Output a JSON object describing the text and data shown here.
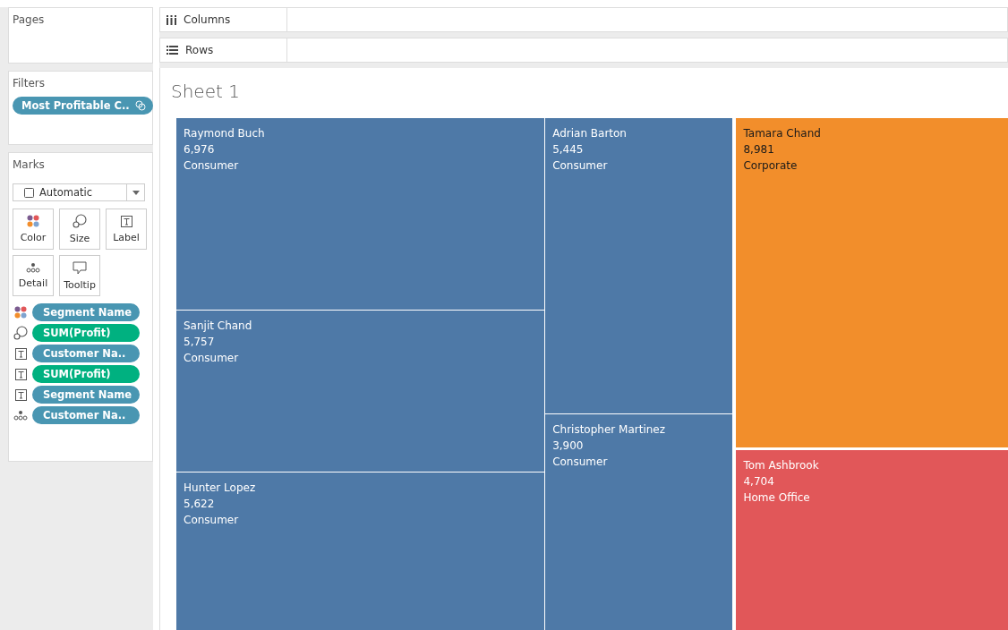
{
  "pages": {
    "title": "Pages"
  },
  "shelves": [
    {
      "kind": "columns",
      "label": "Columns"
    },
    {
      "kind": "rows",
      "label": "Rows"
    }
  ],
  "filters": {
    "title": "Filters",
    "pills": [
      {
        "label": "Most Profitable C..",
        "kind": "set"
      }
    ]
  },
  "marks": {
    "title": "Marks",
    "mark_type": "Automatic",
    "cards": [
      {
        "kind": "color",
        "label": "Color"
      },
      {
        "kind": "size",
        "label": "Size"
      },
      {
        "kind": "label",
        "label": "Label"
      },
      {
        "kind": "detail",
        "label": "Detail"
      },
      {
        "kind": "tooltip",
        "label": "Tooltip"
      }
    ],
    "fields": [
      {
        "kind": "color",
        "label": "Segment Name",
        "color": "#4996b2"
      },
      {
        "kind": "size",
        "label": "SUM(Profit)",
        "color": "#00b180"
      },
      {
        "kind": "label",
        "label": "Customer Na..",
        "color": "#4996b2"
      },
      {
        "kind": "label",
        "label": "SUM(Profit)",
        "color": "#00b180"
      },
      {
        "kind": "label",
        "label": "Segment Name",
        "color": "#4996b2"
      },
      {
        "kind": "detail",
        "label": "Customer Na..",
        "color": "#4996b2"
      }
    ]
  },
  "sheet": {
    "title": "Sheet 1",
    "treemap": [
      {
        "tiles": [
          {
            "name": "Raymond Buch",
            "value": "6,976",
            "segment": "Consumer",
            "color": "#4e79a7"
          },
          {
            "name": "Sanjit Chand",
            "value": "5,757",
            "segment": "Consumer",
            "color": "#4e79a7"
          },
          {
            "name": "Hunter Lopez",
            "value": "5,622",
            "segment": "Consumer",
            "color": "#4e79a7"
          }
        ]
      },
      {
        "tiles": [
          {
            "name": "Adrian Barton",
            "value": "5,445",
            "segment": "Consumer",
            "color": "#4e79a7"
          },
          {
            "name": "Christopher Martinez",
            "value": "3,900",
            "segment": "Consumer",
            "color": "#4e79a7"
          }
        ]
      },
      {
        "tiles": [
          {
            "name": "Tamara Chand",
            "value": "8,981",
            "segment": "Corporate",
            "color": "#f28e2b"
          },
          {
            "name": "Tom Ashbrook",
            "value": "4,704",
            "segment": "Home Office",
            "color": "#e15759"
          }
        ]
      }
    ]
  }
}
